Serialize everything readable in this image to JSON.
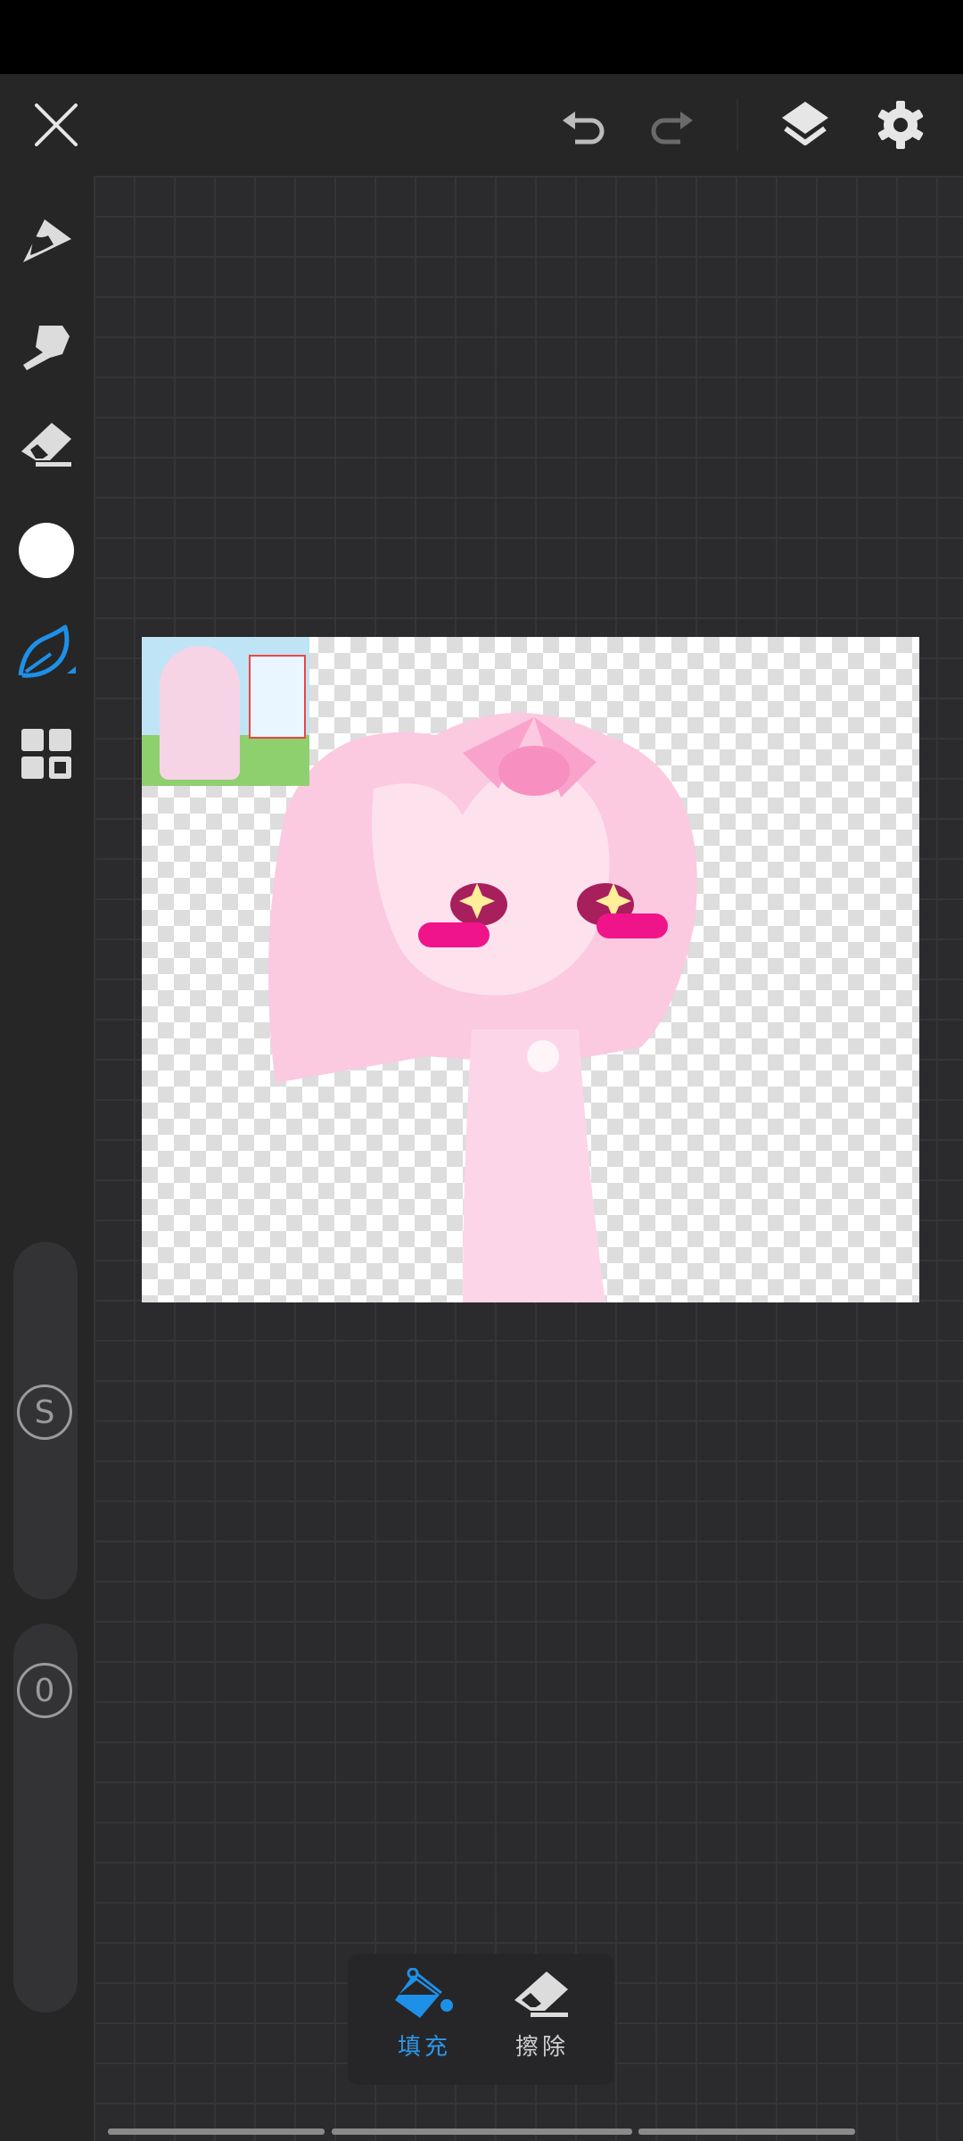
{
  "topbar": {
    "icons": [
      "close-icon",
      "undo-icon",
      "redo-icon",
      "layers-icon",
      "settings-icon"
    ]
  },
  "sidebar": {
    "tools": [
      "pen-tool-icon",
      "smudge-tool-icon",
      "eraser-tool-icon",
      "color-swatch",
      "brush-leaf-icon",
      "grid-menu-icon"
    ],
    "active_tool": "brush-leaf-icon",
    "active_color": "#ffffff"
  },
  "sliders": {
    "size_label": "S",
    "opacity_label": "0"
  },
  "fill_panel": {
    "fill_label": "填充",
    "erase_label": "擦除",
    "active": "fill"
  },
  "colors": {
    "accent": "#1e90e8",
    "background": "#2b2b2d",
    "toolbar": "#262626"
  }
}
